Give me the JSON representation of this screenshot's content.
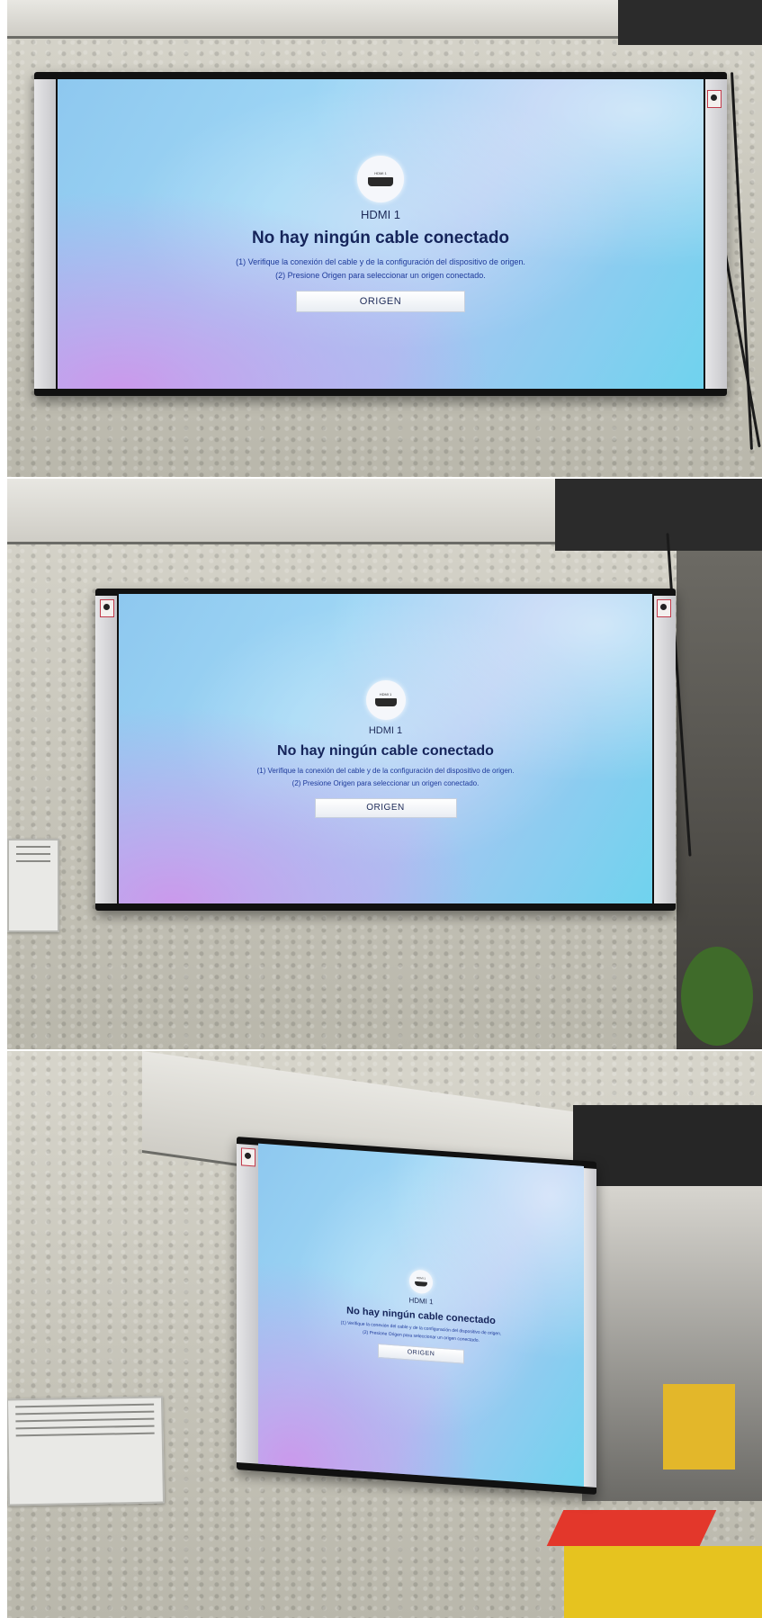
{
  "photos": [
    {
      "screen": {
        "source_badge_text": "HDMI 1",
        "source_label": "HDMI 1",
        "title": "No hay ningún cable conectado",
        "hint_1": "(1) Verifique la conexión del cable y de la configuración del dispositivo de origen.",
        "hint_2": "(2) Presione Origen para seleccionar un origen conectado.",
        "button_label": "ORIGEN"
      }
    },
    {
      "screen": {
        "source_badge_text": "HDMI 1",
        "source_label": "HDMI 1",
        "title": "No hay ningún cable conectado",
        "hint_1": "(1) Verifique la conexión del cable y de la configuración del dispositivo de origen.",
        "hint_2": "(2) Presione Origen para seleccionar un origen conectado.",
        "button_label": "ORIGEN"
      }
    },
    {
      "screen": {
        "source_badge_text": "HDMI 1",
        "source_label": "HDMI 1",
        "title": "No hay ningún cable conectado",
        "hint_1": "(1) Verifique la conexión del cable y de la configuración del dispositivo de origen.",
        "hint_2": "(2) Presione Origen para seleccionar un origen conectado.",
        "button_label": "ORIGEN"
      }
    }
  ],
  "colors": {
    "screen_text": "#1d2a57",
    "hint_text": "#1e3a9a",
    "tv_bezel": "#111111"
  }
}
